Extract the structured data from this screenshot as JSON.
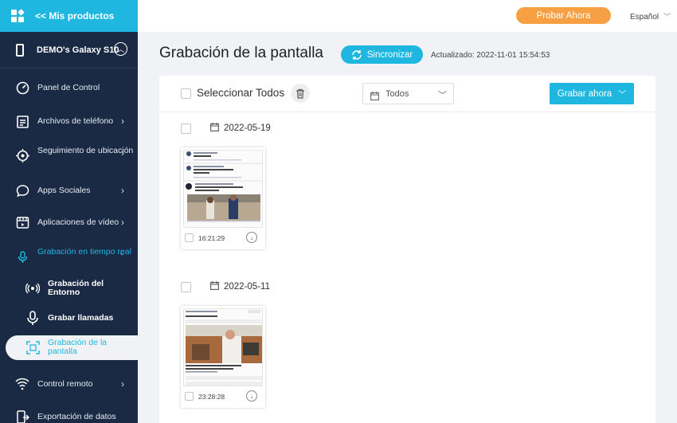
{
  "sidebar": {
    "products_label": "<< Mis productos",
    "device_name": "DEMO's Galaxy S10",
    "items": [
      {
        "label": "Panel de Control"
      },
      {
        "label": "Archivos de teléfono"
      },
      {
        "label": "Seguimiento de ubicación"
      },
      {
        "label": "Apps Sociales"
      },
      {
        "label": "Aplicaciones de vídeo"
      },
      {
        "label": "Grabación en tiempo real"
      },
      {
        "label": "Control remoto"
      },
      {
        "label": "Exportación de datos"
      }
    ],
    "subitems": [
      {
        "label": "Grabación del Entorno"
      },
      {
        "label": "Grabar llamadas"
      },
      {
        "label": "Grabación de la pantalla"
      }
    ]
  },
  "topbar": {
    "try_label": "Probar Ahora",
    "language": "Español"
  },
  "header": {
    "title": "Grabación de la pantalla",
    "sync_label": "Sincronizar",
    "updated": "Actualizado: 2022-11-01 15:54:53"
  },
  "toolbar": {
    "select_all": "Seleccionar Todos",
    "filter_value": "Todos",
    "record_label": "Grabar ahora"
  },
  "groups": [
    {
      "date": "2022-05-19",
      "items": [
        {
          "time": "16:21:29"
        }
      ]
    },
    {
      "date": "2022-05-11",
      "items": [
        {
          "time": "23:28:28"
        }
      ]
    }
  ],
  "colors": {
    "accent": "#1fb7e0",
    "sidebar": "#1b2a44",
    "try_button": "#f7a043"
  }
}
